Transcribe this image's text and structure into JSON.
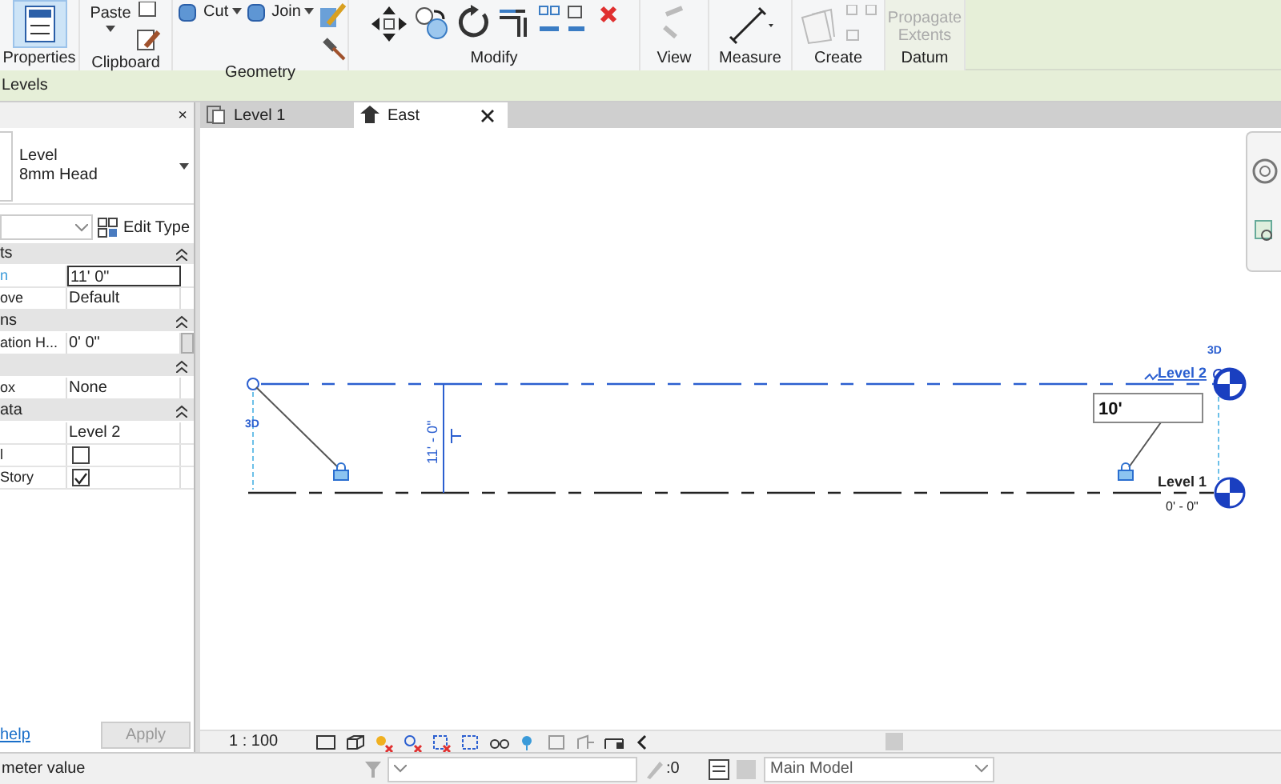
{
  "ribbon": {
    "panels": [
      {
        "title": "Properties",
        "tools": [
          {
            "kind": "toggle",
            "selected": true
          }
        ]
      },
      {
        "title": "Clipboard",
        "tools": [
          {
            "kind": "large",
            "label": "Paste"
          }
        ]
      },
      {
        "title": "Geometry",
        "tools": [
          {
            "kind": "small",
            "label": "Cut"
          },
          {
            "kind": "small",
            "label": "Join"
          }
        ]
      },
      {
        "title": "Modify"
      },
      {
        "title": "View"
      },
      {
        "title": "Measure"
      },
      {
        "title": "Create"
      },
      {
        "title": "Datum",
        "tools": [
          {
            "kind": "text",
            "label": "Propagate Extents",
            "disabled": true
          }
        ]
      }
    ]
  },
  "context_bar": {
    "label": "Levels"
  },
  "properties": {
    "close": "×",
    "type_selector": {
      "family": "Level",
      "type": "8mm Head"
    },
    "edit_type": "Edit Type",
    "groups": [
      {
        "title": "ts",
        "rows": [
          {
            "kind": "edit",
            "name": "n",
            "value": "11'  0\""
          },
          {
            "kind": "text",
            "name": "ove",
            "value": "Default"
          }
        ]
      },
      {
        "title": "ns",
        "rows": [
          {
            "kind": "text",
            "name": "ation H...",
            "value": "0'  0\""
          }
        ]
      },
      {
        "rows": [
          {
            "kind": "text",
            "name": "ox",
            "value": "None"
          }
        ]
      },
      {
        "title": "ata",
        "rows": [
          {
            "kind": "text",
            "value": "Level 2"
          },
          {
            "kind": "check",
            "name": "l",
            "checked": false
          },
          {
            "kind": "check",
            "name": "Story",
            "checked": true
          }
        ]
      }
    ],
    "help": "help",
    "apply": {
      "label": "Apply",
      "disabled": true
    }
  },
  "tabs": [
    {
      "label": "Level 1",
      "selected": false
    },
    {
      "label": "East",
      "selected": true
    }
  ],
  "canvas": {
    "levels": [
      {
        "name": "Level 2",
        "selected": true
      },
      {
        "name": "Level 1",
        "selected": false,
        "elevation": "0' - 0\""
      }
    ],
    "extent_labels": [
      "3D",
      "3D"
    ],
    "dimension": "11' - 0\"",
    "edit_value": "10'"
  },
  "view_bar": {
    "scale": "1 : 100"
  },
  "status_bar": {
    "message": "meter value",
    "workset": ":0",
    "model": "Main Model"
  }
}
